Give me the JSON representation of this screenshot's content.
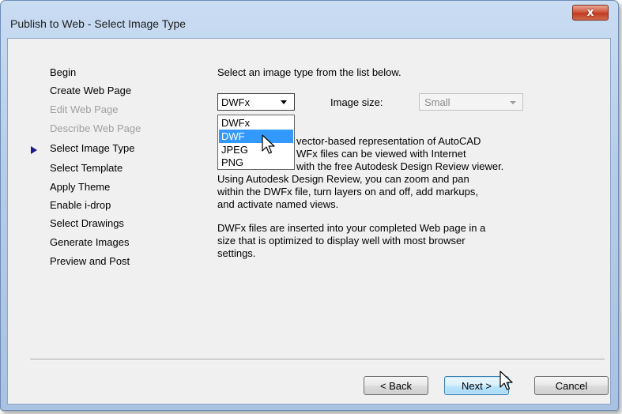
{
  "window": {
    "title": "Publish to Web - Select Image Type",
    "close_glyph": "x"
  },
  "nav": {
    "items": [
      {
        "label": "Begin",
        "enabled": true
      },
      {
        "label": "Create Web Page",
        "enabled": true
      },
      {
        "label": "Edit Web Page",
        "enabled": false
      },
      {
        "label": "Describe Web Page",
        "enabled": false
      },
      {
        "label": "Select Image Type",
        "enabled": true,
        "current": true
      },
      {
        "label": "Select Template",
        "enabled": true
      },
      {
        "label": "Apply Theme",
        "enabled": true
      },
      {
        "label": "Enable i-drop",
        "enabled": true
      },
      {
        "label": "Select Drawings",
        "enabled": true
      },
      {
        "label": "Generate Images",
        "enabled": true
      },
      {
        "label": "Preview and Post",
        "enabled": true
      }
    ]
  },
  "main": {
    "instruction": "Select an image type from the list below.",
    "image_type": {
      "value": "DWFx",
      "options": [
        "DWFx",
        "DWF",
        "JPEG",
        "PNG"
      ],
      "highlighted": "DWF"
    },
    "image_size": {
      "label": "Image size:",
      "value": "Small",
      "enabled": false
    },
    "description_lines_1": [
      "vector-based representation of AutoCAD",
      "WFx files can be viewed with Internet",
      "with the free Autodesk Design Review viewer.",
      "Using Autodesk Design Review, you can zoom and pan",
      "within the DWFx file, turn layers on and off, add markups,",
      "and activate named views."
    ],
    "description_lines_2": [
      "DWFx files are inserted into your completed Web page in a",
      "size that is optimized to display well with most browser",
      "settings."
    ]
  },
  "buttons": {
    "back": "< Back",
    "next": "Next >",
    "cancel": "Cancel"
  },
  "colors": {
    "selection": "#3399ff",
    "nav_arrow": "#1c1c8c",
    "close_button": "#c23a1f"
  },
  "icons": [
    "close-icon",
    "nav-current-arrow-icon",
    "dropdown-arrow-icon",
    "mouse-pointer-icon"
  ]
}
